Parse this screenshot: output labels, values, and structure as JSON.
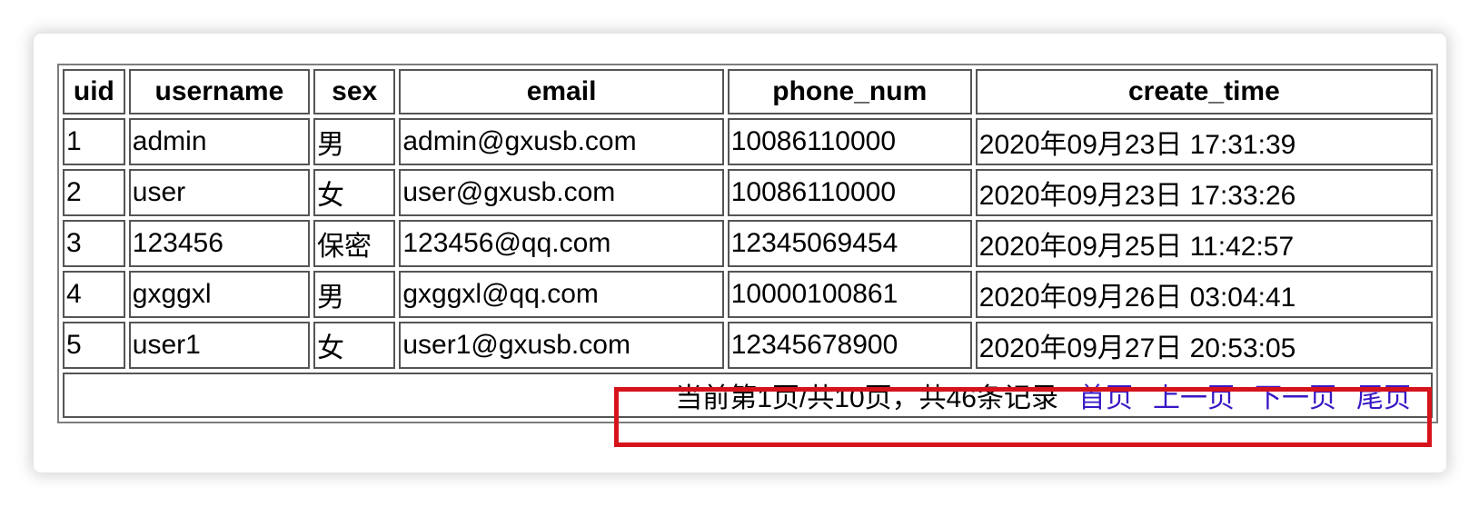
{
  "table": {
    "headers": [
      "uid",
      "username",
      "sex",
      "email",
      "phone_num",
      "create_time"
    ],
    "rows": [
      [
        "1",
        "admin",
        "男",
        "admin@gxusb.com",
        "10086110000",
        "2020年09月23日 17:31:39"
      ],
      [
        "2",
        "user",
        "女",
        "user@gxusb.com",
        "10086110000",
        "2020年09月23日 17:33:26"
      ],
      [
        "3",
        "123456",
        "保密",
        "123456@qq.com",
        "12345069454",
        "2020年09月25日 11:42:57"
      ],
      [
        "4",
        "gxggxl",
        "男",
        "gxggxl@qq.com",
        "10000100861",
        "2020年09月26日 03:04:41"
      ],
      [
        "5",
        "user1",
        "女",
        "user1@gxusb.com",
        "12345678900",
        "2020年09月27日 20:53:05"
      ]
    ]
  },
  "pager": {
    "status": "当前第1页/共10页，共46条记录",
    "first": "首页",
    "prev": "上一页",
    "next": "下一页",
    "last": "尾页"
  },
  "colors": {
    "link": "#3a17c4",
    "highlight": "#d6131b"
  }
}
